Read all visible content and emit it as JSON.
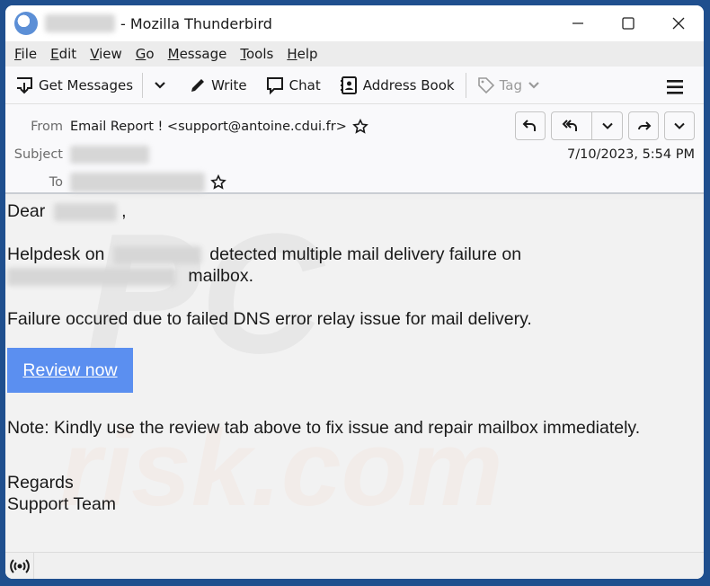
{
  "window": {
    "app_name": "- Mozilla Thunderbird",
    "controls": {
      "minimize": "minimize",
      "maximize": "maximize",
      "close": "close"
    }
  },
  "menu": {
    "items": [
      {
        "label": "File",
        "accel": "F",
        "rest": "ile"
      },
      {
        "label": "Edit",
        "accel": "E",
        "rest": "dit"
      },
      {
        "label": "View",
        "accel": "V",
        "rest": "iew"
      },
      {
        "label": "Go",
        "accel": "G",
        "rest": "o"
      },
      {
        "label": "Message",
        "accel": "M",
        "rest": "essage"
      },
      {
        "label": "Tools",
        "accel": "T",
        "rest": "ools"
      },
      {
        "label": "Help",
        "accel": "H",
        "rest": "elp"
      }
    ]
  },
  "toolbar": {
    "get_messages": "Get Messages",
    "write": "Write",
    "chat": "Chat",
    "address_book": "Address Book",
    "tag": "Tag"
  },
  "header": {
    "from_label": "From",
    "from_value": "Email Report ! <support@antoine.cdui.fr>",
    "subject_label": "Subject",
    "to_label": "To",
    "date": "7/10/2023, 5:54 PM"
  },
  "message": {
    "greeting": "Dear",
    "greeting_suffix": ",",
    "line1_start": "Helpdesk on",
    "line1_end": "detected multiple mail delivery failure on",
    "line2_end": "mailbox.",
    "line3": "Failure occured due to failed DNS error relay issue for mail delivery.",
    "button": "Review now",
    "note": "Note:  Kindly use the review tab above to fix issue and repair mailbox immediately.",
    "regards": "Regards",
    "signature": "Support Team"
  },
  "colors": {
    "review_button": "#5b8ff0",
    "desktop": "#1f4f8e"
  }
}
